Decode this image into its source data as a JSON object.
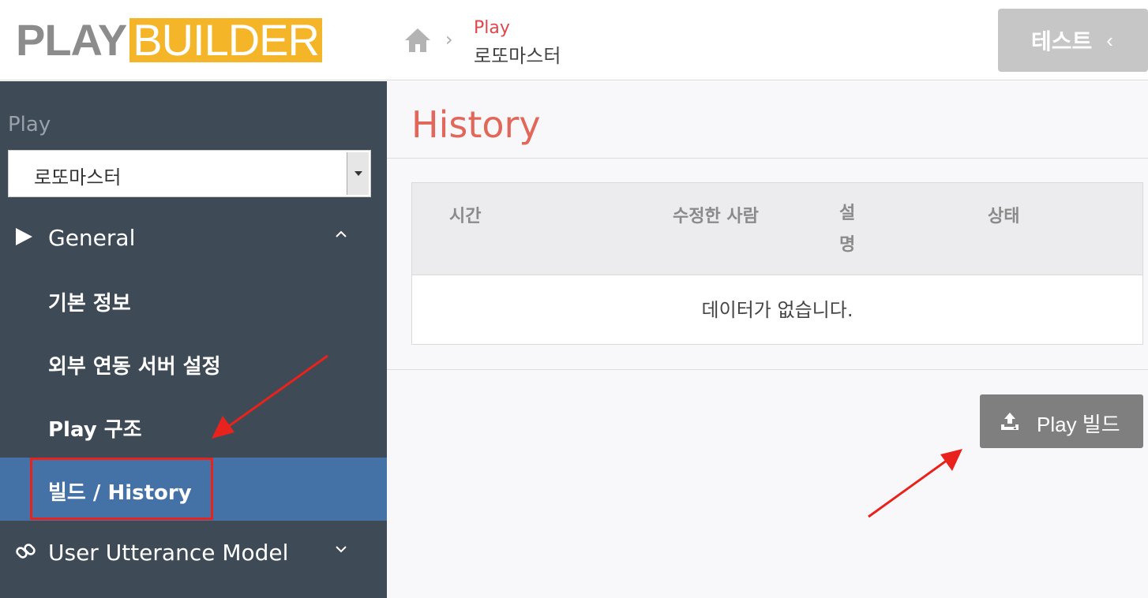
{
  "header": {
    "logo_left": "PLAY",
    "logo_right": "BUILDER",
    "breadcrumb": {
      "parent": "Play",
      "current": "로또마스터"
    },
    "test_button": "테스트",
    "test_chevron": "‹"
  },
  "sidebar": {
    "play_label": "Play",
    "selected_play": "로또마스터",
    "sections": [
      {
        "label": "General",
        "caret": "^",
        "icon": "play-triangle-icon"
      },
      {
        "label": "User Utterance Model",
        "caret": "v",
        "icon": "link-icon"
      }
    ],
    "items": [
      {
        "label": "기본 정보"
      },
      {
        "label": "외부 연동 서버 설정"
      },
      {
        "label": "Play 구조"
      },
      {
        "label": "빌드 / History",
        "active": true
      }
    ]
  },
  "main": {
    "title": "History",
    "table": {
      "columns": [
        "시간",
        "수정한 사람",
        "설명",
        "상태"
      ],
      "empty_message": "데이터가 없습니다."
    },
    "build_button": "Play 빌드"
  },
  "colors": {
    "sidebar_bg": "#3e4a56",
    "active_item_bg": "#4471a6",
    "title_color": "#e0675a",
    "annotation_red": "#e8231d",
    "logo_yellow": "#f5b528"
  }
}
